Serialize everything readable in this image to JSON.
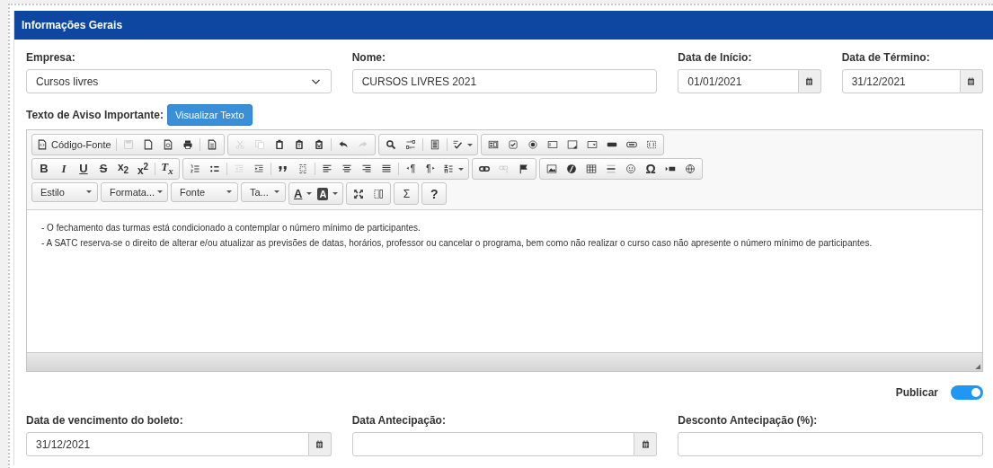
{
  "panel": {
    "title": "Informações Gerais"
  },
  "fields_top": [
    {
      "kind": "select",
      "label": "Empresa:",
      "value": "Cursos livres"
    },
    {
      "kind": "text",
      "label": "Nome:",
      "value": "CURSOS LIVRES 2021"
    },
    {
      "kind": "date",
      "label": "Data de Início:",
      "value": "01/01/2021"
    },
    {
      "kind": "date",
      "label": "Data de Término:",
      "value": "31/12/2021"
    }
  ],
  "notice": {
    "label": "Texto de Aviso Importante:",
    "button": "Visualizar Texto"
  },
  "editor": {
    "toolbar_rows": [
      [
        [
          {
            "kind": "source",
            "label": "Código-Fonte",
            "disabled": false
          },
          {
            "kind": "sep"
          },
          {
            "kind": "save",
            "disabled": true
          },
          {
            "kind": "newpage",
            "disabled": false
          },
          {
            "kind": "preview",
            "disabled": false
          },
          {
            "kind": "print",
            "disabled": false
          },
          {
            "kind": "sep"
          },
          {
            "kind": "templates",
            "disabled": false
          }
        ],
        [
          {
            "kind": "cut",
            "disabled": true
          },
          {
            "kind": "copy",
            "disabled": true
          },
          {
            "kind": "paste",
            "disabled": false
          },
          {
            "kind": "pastetext",
            "disabled": false
          },
          {
            "kind": "pasteword",
            "disabled": false
          },
          {
            "kind": "sep"
          },
          {
            "kind": "undo",
            "disabled": false
          },
          {
            "kind": "redo",
            "disabled": true
          }
        ],
        [
          {
            "kind": "find",
            "disabled": false
          },
          {
            "kind": "replace",
            "disabled": false
          },
          {
            "kind": "sep"
          },
          {
            "kind": "selectall",
            "disabled": false
          },
          {
            "kind": "sep"
          },
          {
            "kind": "spell",
            "disabled": false,
            "dropdown": true
          }
        ],
        [
          {
            "kind": "form",
            "disabled": false
          },
          {
            "kind": "checkbox",
            "disabled": false
          },
          {
            "kind": "radio",
            "disabled": false
          },
          {
            "kind": "textfield",
            "disabled": false
          },
          {
            "kind": "textarea",
            "disabled": false
          },
          {
            "kind": "select",
            "disabled": false
          },
          {
            "kind": "button",
            "disabled": false
          },
          {
            "kind": "imagebutton",
            "disabled": false
          },
          {
            "kind": "hidden",
            "disabled": false
          }
        ]
      ],
      [
        [
          {
            "kind": "bold",
            "glyph": "B",
            "disabled": false
          },
          {
            "kind": "italic",
            "glyph": "I",
            "disabled": false
          },
          {
            "kind": "underline",
            "glyph": "U",
            "disabled": false
          },
          {
            "kind": "strike",
            "glyph": "S",
            "disabled": false
          },
          {
            "kind": "sub",
            "glyph": "x$_{2}$",
            "disabled": false
          },
          {
            "kind": "sup",
            "glyph": "x$^{2}$",
            "disabled": false
          },
          {
            "kind": "sep"
          },
          {
            "kind": "removeformat",
            "glyph": "T$_{x}$",
            "disabled": false
          }
        ],
        [
          {
            "kind": "ol",
            "disabled": false
          },
          {
            "kind": "ul",
            "disabled": false
          },
          {
            "kind": "sep"
          },
          {
            "kind": "outdent",
            "disabled": true
          },
          {
            "kind": "indent",
            "disabled": false
          },
          {
            "kind": "sep"
          },
          {
            "kind": "quote",
            "disabled": false
          },
          {
            "kind": "div",
            "disabled": false
          },
          {
            "kind": "sep"
          },
          {
            "kind": "left",
            "disabled": false
          },
          {
            "kind": "center",
            "disabled": false
          },
          {
            "kind": "right",
            "disabled": false
          },
          {
            "kind": "justify",
            "disabled": false
          },
          {
            "kind": "sep"
          },
          {
            "kind": "ltr",
            "disabled": false
          },
          {
            "kind": "rtl",
            "disabled": false
          },
          {
            "kind": "language",
            "disabled": false,
            "dropdown": true
          }
        ],
        [
          {
            "kind": "link",
            "disabled": false
          },
          {
            "kind": "unlink",
            "disabled": true
          },
          {
            "kind": "anchor",
            "disabled": false
          }
        ],
        [
          {
            "kind": "image",
            "disabled": false
          },
          {
            "kind": "flash",
            "disabled": false
          },
          {
            "kind": "table",
            "disabled": false
          },
          {
            "kind": "hr",
            "disabled": false
          },
          {
            "kind": "smiley",
            "disabled": false
          },
          {
            "kind": "specialchar",
            "glyph": "Ω",
            "disabled": false
          },
          {
            "kind": "pagebreak",
            "disabled": false
          },
          {
            "kind": "iframe",
            "disabled": false
          }
        ]
      ],
      [
        [
          {
            "kind": "combo",
            "label": "Estilo"
          }
        ],
        [
          {
            "kind": "combo",
            "label": "Formata..."
          }
        ],
        [
          {
            "kind": "combo",
            "label": "Fonte"
          }
        ],
        [
          {
            "kind": "combo",
            "label": "Ta..."
          }
        ],
        [
          {
            "kind": "textcolor",
            "glyph": "A",
            "disabled": false,
            "dropdown": true
          },
          {
            "kind": "bgcolor",
            "glyph": "A",
            "disabled": false,
            "dropdown": true
          }
        ],
        [
          {
            "kind": "maximize",
            "disabled": false
          },
          {
            "kind": "showblocks",
            "disabled": false
          }
        ],
        [
          {
            "kind": "sigma",
            "glyph": "Σ",
            "disabled": false
          }
        ],
        [
          {
            "kind": "help",
            "glyph": "?",
            "disabled": false
          }
        ]
      ]
    ],
    "content": [
      "- O fechamento das turmas está condicionado a contemplar o número mínimo de participantes.",
      "- A SATC reserva-se o direito de alterar e/ou atualizar as previsões de datas, horários, professor ou cancelar o programa, bem como não realizar o curso caso não apresente o número mínimo de participantes."
    ]
  },
  "publish": {
    "label": "Publicar",
    "on": true
  },
  "fields_bottom": [
    {
      "kind": "date",
      "label": "Data de vencimento do boleto:",
      "value": "31/12/2021"
    },
    {
      "kind": "date",
      "label": "Data Antecipação:"
    },
    {
      "kind": "text",
      "label": "Desconto Antecipação (%):"
    }
  ]
}
